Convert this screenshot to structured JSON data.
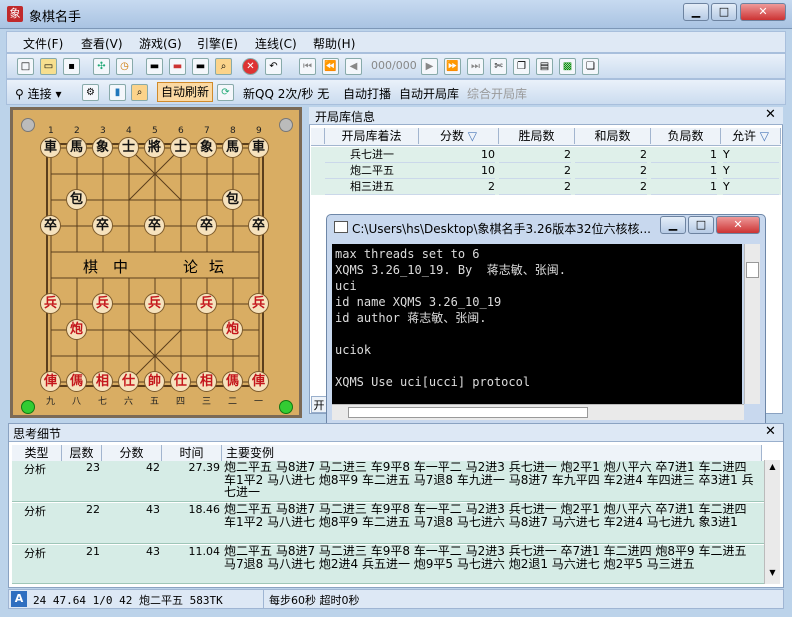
{
  "window": {
    "title": "象棋名手",
    "app_icon_glyph": "象"
  },
  "window_controls": {
    "minimize": "▁",
    "maximize": "□",
    "close": "✕"
  },
  "menu": [
    "文件(F)",
    "查看(V)",
    "游戏(G)",
    "引擎(E)",
    "连线(C)",
    "帮助(H)"
  ],
  "toolbar1": {
    "counter": "000/000"
  },
  "toolbar2": {
    "connect": "连接",
    "auto_refresh": "自动刷新",
    "speed": "新QQ 2次/秒 无",
    "auto_play": "自动打播",
    "auto_opening": "自动开局库",
    "combined_opening": "综合开局库"
  },
  "board": {
    "top_numbers": [
      "1",
      "2",
      "3",
      "4",
      "5",
      "6",
      "7",
      "8",
      "9"
    ],
    "bottom_numbers": [
      "九",
      "八",
      "七",
      "六",
      "五",
      "四",
      "三",
      "二",
      "一"
    ],
    "river_text": [
      "棋",
      "中",
      "论",
      "坛"
    ],
    "pieces": {
      "black_back": [
        "車",
        "馬",
        "象",
        "士",
        "將",
        "士",
        "象",
        "馬",
        "車"
      ],
      "black_cannon": "包",
      "black_soldier": "卒",
      "red_soldier": "兵",
      "red_cannon": "炮",
      "red_back": [
        "俥",
        "傌",
        "相",
        "仕",
        "帥",
        "仕",
        "相",
        "傌",
        "俥"
      ]
    }
  },
  "opening": {
    "title": "开局库信息",
    "columns": [
      "开局库着法",
      "分数",
      "胜局数",
      "和局数",
      "负局数",
      "允许"
    ],
    "rows": [
      {
        "move": "兵七进一",
        "score": "10",
        "win": "2",
        "draw": "2",
        "loss": "1",
        "allow": "Y"
      },
      {
        "move": "炮二平五",
        "score": "10",
        "win": "2",
        "draw": "2",
        "loss": "1",
        "allow": "Y"
      },
      {
        "move": "相三进五",
        "score": "2",
        "win": "2",
        "draw": "2",
        "loss": "1",
        "allow": "Y"
      }
    ],
    "bottom_tab": "开"
  },
  "console": {
    "title": "C:\\Users\\hs\\Desktop\\象棋名手3.26版本32位六核核...",
    "lines": [
      "max threads set to 6",
      "XQMS 3.26_10_19. By  蒋志敏、张闽.",
      "uci",
      "id name XQMS 3.26_10_19",
      "id author 蒋志敏、张闽.",
      "",
      "uciok",
      "",
      "XQMS Use uci[ucci] protocol"
    ]
  },
  "thinking": {
    "title": "思考细节",
    "columns": [
      "类型",
      "层数",
      "分数",
      "时间",
      "主要变例"
    ],
    "rows": [
      {
        "type": "分析",
        "depth": "23",
        "score": "42",
        "time": "27.39",
        "pv": "炮二平五 马8进7 马二进三 车9平8 车一平二 马2进3 兵七进一 炮2平1 炮八平六 卒7进1 车二进四 车1平2 马八进七 炮8平9 车二进五 马7退8 车九进一 马8进7 车九平四 车2进4 车四进三 卒3进1 兵七进一"
      },
      {
        "type": "分析",
        "depth": "22",
        "score": "43",
        "time": "18.46",
        "pv": "炮二平五 马8进7 马二进三 车9平8 车一平二 马2进3 兵七进一 炮2平1 炮八平六 卒7进1 车二进四 车1平2 马八进七 炮8平9 车二进五 马7退8 马七进六 马8进7 马六进七 车2进4 马七进九 象3进1"
      },
      {
        "type": "分析",
        "depth": "21",
        "score": "43",
        "time": "11.04",
        "pv": "炮二平五 马8进7 马二进三 车9平8 车一平二 马2进3 兵七进一 卒7进1 车二进四 炮8平9 车二进五 马7退8 马八进七 炮2进4 兵五进一 炮9平5 马七进六 炮2退1 马六进七 炮2平5 马三进五"
      }
    ]
  },
  "status": {
    "icon": "A",
    "info": "24 47.64 1/0 42 炮二平五 583TK",
    "timing": "每步60秒  超时0秒"
  }
}
